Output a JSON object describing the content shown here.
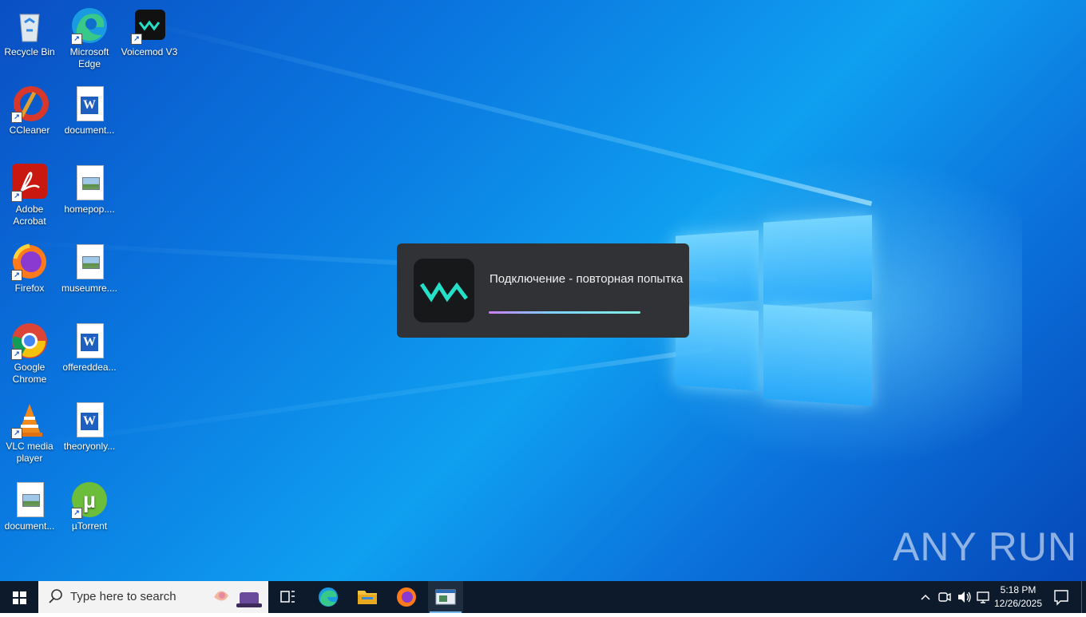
{
  "desktop_icons": [
    {
      "label": "Recycle Bin"
    },
    {
      "label": "Microsoft Edge"
    },
    {
      "label": "Voicemod V3"
    },
    {
      "label": "CCleaner"
    },
    {
      "label": "document..."
    },
    {
      "label": "Adobe Acrobat"
    },
    {
      "label": "homepop...."
    },
    {
      "label": "Firefox"
    },
    {
      "label": "museumre...."
    },
    {
      "label": "Google Chrome"
    },
    {
      "label": "offereddea..."
    },
    {
      "label": "VLC media player"
    },
    {
      "label": "theoryonly..."
    },
    {
      "label": "document..."
    },
    {
      "label": "µTorrent"
    }
  ],
  "voicemod_dialog": {
    "message": "Подключение - повторная попытка",
    "logo_text": "VM"
  },
  "watermark": {
    "text": "ANY RUN"
  },
  "taskbar": {
    "search_placeholder": "Type here to search",
    "time": "5:18 PM",
    "date": "12/26/2025"
  },
  "colors": {
    "taskbar": "#0c1a2b",
    "dialog_bg": "#303235",
    "voicemod_accent": "#25e0c8"
  }
}
